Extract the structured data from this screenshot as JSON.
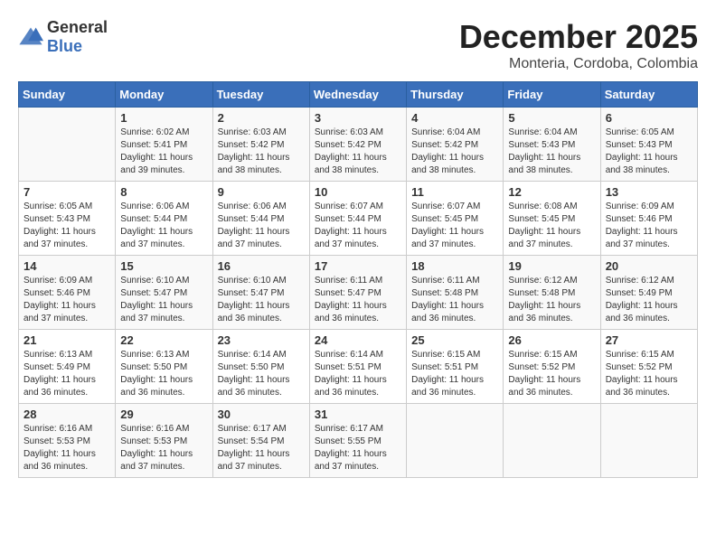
{
  "logo": {
    "general": "General",
    "blue": "Blue"
  },
  "title": {
    "month": "December 2025",
    "location": "Monteria, Cordoba, Colombia"
  },
  "weekdays": [
    "Sunday",
    "Monday",
    "Tuesday",
    "Wednesday",
    "Thursday",
    "Friday",
    "Saturday"
  ],
  "weeks": [
    [
      {
        "day": "",
        "sunrise": "",
        "sunset": "",
        "daylight": ""
      },
      {
        "day": "1",
        "sunrise": "Sunrise: 6:02 AM",
        "sunset": "Sunset: 5:41 PM",
        "daylight": "Daylight: 11 hours and 39 minutes."
      },
      {
        "day": "2",
        "sunrise": "Sunrise: 6:03 AM",
        "sunset": "Sunset: 5:42 PM",
        "daylight": "Daylight: 11 hours and 38 minutes."
      },
      {
        "day": "3",
        "sunrise": "Sunrise: 6:03 AM",
        "sunset": "Sunset: 5:42 PM",
        "daylight": "Daylight: 11 hours and 38 minutes."
      },
      {
        "day": "4",
        "sunrise": "Sunrise: 6:04 AM",
        "sunset": "Sunset: 5:42 PM",
        "daylight": "Daylight: 11 hours and 38 minutes."
      },
      {
        "day": "5",
        "sunrise": "Sunrise: 6:04 AM",
        "sunset": "Sunset: 5:43 PM",
        "daylight": "Daylight: 11 hours and 38 minutes."
      },
      {
        "day": "6",
        "sunrise": "Sunrise: 6:05 AM",
        "sunset": "Sunset: 5:43 PM",
        "daylight": "Daylight: 11 hours and 38 minutes."
      }
    ],
    [
      {
        "day": "7",
        "sunrise": "Sunrise: 6:05 AM",
        "sunset": "Sunset: 5:43 PM",
        "daylight": "Daylight: 11 hours and 37 minutes."
      },
      {
        "day": "8",
        "sunrise": "Sunrise: 6:06 AM",
        "sunset": "Sunset: 5:44 PM",
        "daylight": "Daylight: 11 hours and 37 minutes."
      },
      {
        "day": "9",
        "sunrise": "Sunrise: 6:06 AM",
        "sunset": "Sunset: 5:44 PM",
        "daylight": "Daylight: 11 hours and 37 minutes."
      },
      {
        "day": "10",
        "sunrise": "Sunrise: 6:07 AM",
        "sunset": "Sunset: 5:44 PM",
        "daylight": "Daylight: 11 hours and 37 minutes."
      },
      {
        "day": "11",
        "sunrise": "Sunrise: 6:07 AM",
        "sunset": "Sunset: 5:45 PM",
        "daylight": "Daylight: 11 hours and 37 minutes."
      },
      {
        "day": "12",
        "sunrise": "Sunrise: 6:08 AM",
        "sunset": "Sunset: 5:45 PM",
        "daylight": "Daylight: 11 hours and 37 minutes."
      },
      {
        "day": "13",
        "sunrise": "Sunrise: 6:09 AM",
        "sunset": "Sunset: 5:46 PM",
        "daylight": "Daylight: 11 hours and 37 minutes."
      }
    ],
    [
      {
        "day": "14",
        "sunrise": "Sunrise: 6:09 AM",
        "sunset": "Sunset: 5:46 PM",
        "daylight": "Daylight: 11 hours and 37 minutes."
      },
      {
        "day": "15",
        "sunrise": "Sunrise: 6:10 AM",
        "sunset": "Sunset: 5:47 PM",
        "daylight": "Daylight: 11 hours and 37 minutes."
      },
      {
        "day": "16",
        "sunrise": "Sunrise: 6:10 AM",
        "sunset": "Sunset: 5:47 PM",
        "daylight": "Daylight: 11 hours and 36 minutes."
      },
      {
        "day": "17",
        "sunrise": "Sunrise: 6:11 AM",
        "sunset": "Sunset: 5:47 PM",
        "daylight": "Daylight: 11 hours and 36 minutes."
      },
      {
        "day": "18",
        "sunrise": "Sunrise: 6:11 AM",
        "sunset": "Sunset: 5:48 PM",
        "daylight": "Daylight: 11 hours and 36 minutes."
      },
      {
        "day": "19",
        "sunrise": "Sunrise: 6:12 AM",
        "sunset": "Sunset: 5:48 PM",
        "daylight": "Daylight: 11 hours and 36 minutes."
      },
      {
        "day": "20",
        "sunrise": "Sunrise: 6:12 AM",
        "sunset": "Sunset: 5:49 PM",
        "daylight": "Daylight: 11 hours and 36 minutes."
      }
    ],
    [
      {
        "day": "21",
        "sunrise": "Sunrise: 6:13 AM",
        "sunset": "Sunset: 5:49 PM",
        "daylight": "Daylight: 11 hours and 36 minutes."
      },
      {
        "day": "22",
        "sunrise": "Sunrise: 6:13 AM",
        "sunset": "Sunset: 5:50 PM",
        "daylight": "Daylight: 11 hours and 36 minutes."
      },
      {
        "day": "23",
        "sunrise": "Sunrise: 6:14 AM",
        "sunset": "Sunset: 5:50 PM",
        "daylight": "Daylight: 11 hours and 36 minutes."
      },
      {
        "day": "24",
        "sunrise": "Sunrise: 6:14 AM",
        "sunset": "Sunset: 5:51 PM",
        "daylight": "Daylight: 11 hours and 36 minutes."
      },
      {
        "day": "25",
        "sunrise": "Sunrise: 6:15 AM",
        "sunset": "Sunset: 5:51 PM",
        "daylight": "Daylight: 11 hours and 36 minutes."
      },
      {
        "day": "26",
        "sunrise": "Sunrise: 6:15 AM",
        "sunset": "Sunset: 5:52 PM",
        "daylight": "Daylight: 11 hours and 36 minutes."
      },
      {
        "day": "27",
        "sunrise": "Sunrise: 6:15 AM",
        "sunset": "Sunset: 5:52 PM",
        "daylight": "Daylight: 11 hours and 36 minutes."
      }
    ],
    [
      {
        "day": "28",
        "sunrise": "Sunrise: 6:16 AM",
        "sunset": "Sunset: 5:53 PM",
        "daylight": "Daylight: 11 hours and 36 minutes."
      },
      {
        "day": "29",
        "sunrise": "Sunrise: 6:16 AM",
        "sunset": "Sunset: 5:53 PM",
        "daylight": "Daylight: 11 hours and 37 minutes."
      },
      {
        "day": "30",
        "sunrise": "Sunrise: 6:17 AM",
        "sunset": "Sunset: 5:54 PM",
        "daylight": "Daylight: 11 hours and 37 minutes."
      },
      {
        "day": "31",
        "sunrise": "Sunrise: 6:17 AM",
        "sunset": "Sunset: 5:55 PM",
        "daylight": "Daylight: 11 hours and 37 minutes."
      },
      {
        "day": "",
        "sunrise": "",
        "sunset": "",
        "daylight": ""
      },
      {
        "day": "",
        "sunrise": "",
        "sunset": "",
        "daylight": ""
      },
      {
        "day": "",
        "sunrise": "",
        "sunset": "",
        "daylight": ""
      }
    ]
  ]
}
